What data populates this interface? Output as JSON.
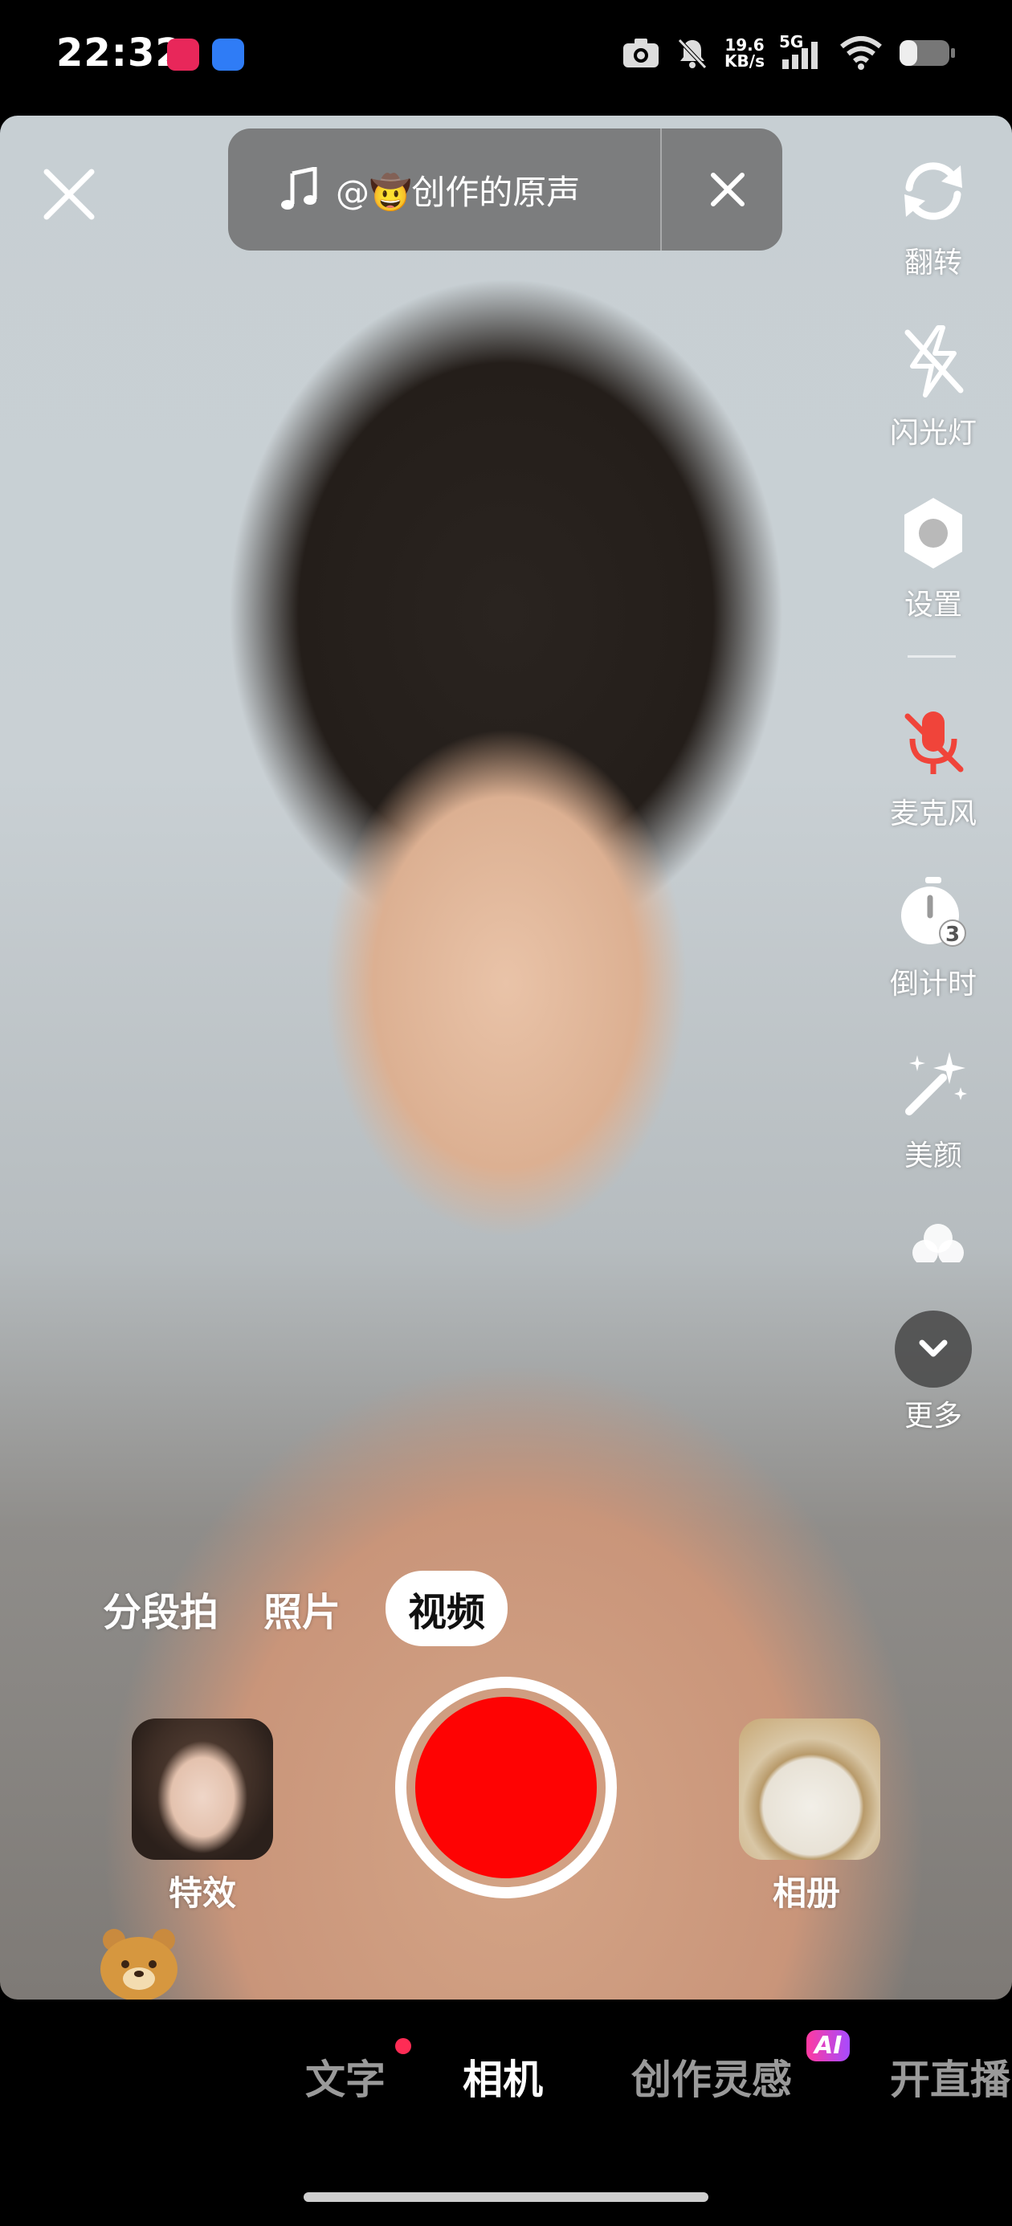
{
  "status_bar": {
    "time": "22:32",
    "network_speed_value": "19.6",
    "network_speed_unit": "KB/s",
    "network_type": "5G",
    "battery_level": 0.35
  },
  "music": {
    "label": "@🤠创作的原声"
  },
  "toolbar": [
    {
      "label": "翻转",
      "icon": "flip-camera-icon"
    },
    {
      "label": "闪光灯",
      "icon": "flash-off-icon"
    },
    {
      "label": "设置",
      "icon": "gear-icon"
    },
    {
      "label": "麦克风",
      "icon": "mic-off-icon"
    },
    {
      "label": "倒计时",
      "icon": "timer-icon",
      "badge": "3"
    },
    {
      "label": "美颜",
      "icon": "beauty-wand-icon"
    },
    {
      "label": "更多",
      "icon": "chevron-down-icon"
    }
  ],
  "modes": [
    {
      "label": "分段拍",
      "active": false
    },
    {
      "label": "照片",
      "active": false
    },
    {
      "label": "视频",
      "active": true
    }
  ],
  "effects_label": "特效",
  "album_label": "相册",
  "bottom_nav": [
    {
      "label": "文字",
      "active": false,
      "dot": true
    },
    {
      "label": "相机",
      "active": true
    },
    {
      "label": "创作灵感",
      "active": false,
      "badge": "AI"
    },
    {
      "label": "开直播",
      "active": false
    }
  ],
  "colors": {
    "record_red": "#fe0303",
    "accent_pink": "#fe2c55"
  }
}
